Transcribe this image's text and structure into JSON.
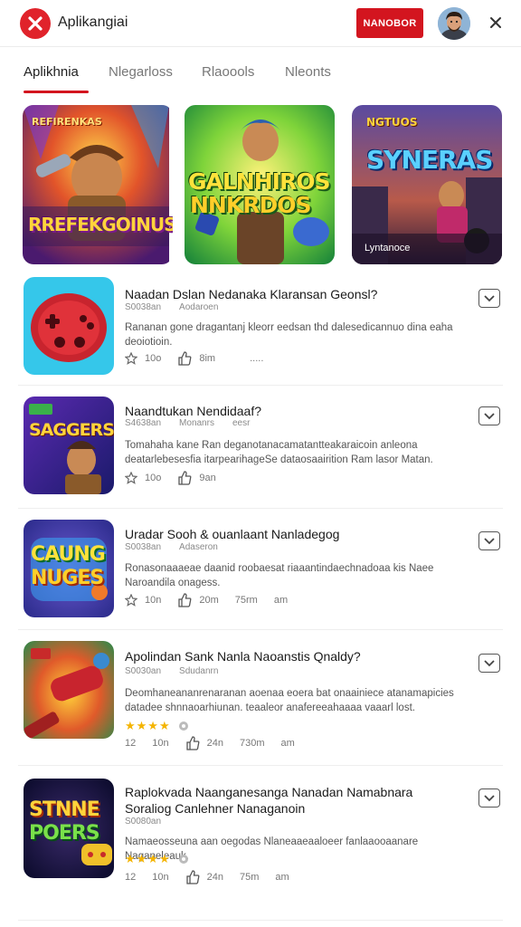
{
  "header": {
    "app_title": "Aplikangiai",
    "primary_button": "NANOBOR",
    "colors": {
      "accent": "#d3151f",
      "logo": "#e0232b"
    }
  },
  "tabs": [
    {
      "label": "Aplikhnia",
      "active": true
    },
    {
      "label": "Nlegarloss",
      "active": false
    },
    {
      "label": "Rlaoools",
      "active": false
    },
    {
      "label": "Nleonts",
      "active": false
    }
  ],
  "banners": [
    {
      "art_title": "RREFEKGOINUS",
      "art_subtitle": "REFIRENKAS"
    },
    {
      "art_title_top": "GALNHIROS",
      "art_title_bottom": "NNKRDOS"
    },
    {
      "art_title": "SYNERAS",
      "art_subtitle": "NGTUOS",
      "caption": "Lyntanoce"
    }
  ],
  "items": [
    {
      "title": "Naadan Dslan Nedanaka Klaransan Geonsl?",
      "meta": [
        "S0038an",
        "Aodaroen"
      ],
      "desc": "Rananan gone dragantanj kleorr eedsan thd dalesedicannuo dina eaha deoiotioin.",
      "rating": "",
      "stats": [
        "10o",
        "8im",
        "....."
      ],
      "icon": "gamepad-icon"
    },
    {
      "title": "Naandtukan Nendidaaf?",
      "meta": [
        "S4638an",
        "Monanrs",
        "eesr"
      ],
      "desc": "Tomahaha kane Ran deganotanacamatantteakaraicoin anleona deatarlebesesfia itarpearihageSe dataosaairition Ram lasor Matan.",
      "rating": "",
      "stats": [
        "10o",
        "9an"
      ],
      "icon": "saggers-game-icon"
    },
    {
      "title": "Uradar Sooh & ouanlaant Nanladegog",
      "meta": [
        "S0038an",
        "Adaseron"
      ],
      "desc": "Ronasonaaaeae daanid roobaesat riaaantindaechnadoaa kis Naee Naroandila onagess.",
      "rating": "",
      "stats": [
        "10n",
        "20m",
        "75rm",
        "am"
      ],
      "icon": "caung-nuges-icon"
    },
    {
      "title": "Apolindan Sank Nanla Naoanstis Qnaldy?",
      "meta": [
        "S0030an",
        "Sdudanrn"
      ],
      "desc": "Deomhaneananrenaranan aoenaa eoera bat onaainiece atanamapicies datadee shnnaoarhiunan. teaaleor anafereeahaaaa vaaarl lost.",
      "rating": "★★★★",
      "stats": [
        "10n",
        "24n",
        "730m",
        "am"
      ],
      "stats_first": "12",
      "icon": "rocket-game-icon"
    },
    {
      "title": "Raplokvada Naanganesanga Nanadan Namabnara Soraliog Canlehner Nanaganoin",
      "meta": [
        "S0080an"
      ],
      "desc": "Namaeosseuna aan oegodas Nlaneaaeaaloeer fanlaaooaanare Naganeleauk.",
      "rating": "★★★★",
      "stats": [
        "10n",
        "24n",
        "75m",
        "am"
      ],
      "stats_first": "12",
      "icon": "stnne-poers-icon"
    }
  ]
}
